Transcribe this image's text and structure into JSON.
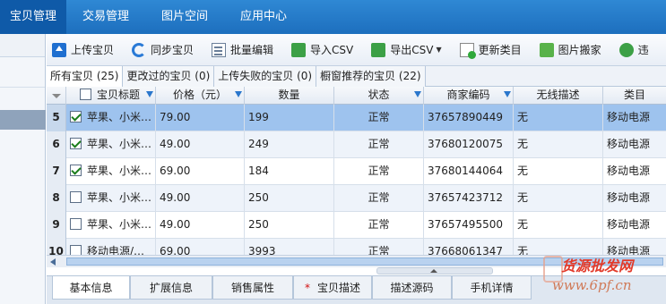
{
  "topnav": {
    "items": [
      {
        "label": "宝贝管理",
        "active": true
      },
      {
        "label": "交易管理"
      },
      {
        "label": "图片空间"
      },
      {
        "label": "应用中心"
      }
    ]
  },
  "toolbar": {
    "upload": "上传宝贝",
    "sync": "同步宝贝",
    "batch_edit": "批量编辑",
    "import_csv": "导入CSV",
    "export_csv": "导出CSV",
    "update_category": "更新类目",
    "image_move": "图片搬家",
    "check": "违"
  },
  "tabs": [
    {
      "label": "所有宝贝 (25)",
      "active": true
    },
    {
      "label": "更改过的宝贝 (0)"
    },
    {
      "label": "上传失败的宝贝 (0)"
    },
    {
      "label": "橱窗推荐的宝贝 (22)"
    }
  ],
  "columns": {
    "title": "宝贝标题",
    "price": "价格（元）",
    "qty": "数量",
    "status": "状态",
    "code": "商家编码",
    "wireless": "无线描述",
    "category": "类目"
  },
  "rows": [
    {
      "num": "5",
      "checked": true,
      "title": "苹果、小米…",
      "price": "79.00",
      "qty": "199",
      "status": "正常",
      "code": "37657890449",
      "wireless": "无",
      "category": "移动电源"
    },
    {
      "num": "6",
      "checked": true,
      "title": "苹果、小米…",
      "price": "49.00",
      "qty": "249",
      "status": "正常",
      "code": "37680120075",
      "wireless": "无",
      "category": "移动电源"
    },
    {
      "num": "7",
      "checked": true,
      "title": "苹果、小米…",
      "price": "69.00",
      "qty": "184",
      "status": "正常",
      "code": "37680144064",
      "wireless": "无",
      "category": "移动电源"
    },
    {
      "num": "8",
      "checked": false,
      "title": "苹果、小米…",
      "price": "49.00",
      "qty": "250",
      "status": "正常",
      "code": "37657423712",
      "wireless": "无",
      "category": "移动电源"
    },
    {
      "num": "9",
      "checked": false,
      "title": "苹果、小米…",
      "price": "49.00",
      "qty": "250",
      "status": "正常",
      "code": "37657495500",
      "wireless": "无",
      "category": "移动电源"
    },
    {
      "num": "10",
      "checked": false,
      "title": "移动电源/…",
      "price": "69.00",
      "qty": "3993",
      "status": "正常",
      "code": "37668061347",
      "wireless": "无",
      "category": "移动电源"
    }
  ],
  "bottom_tabs": [
    {
      "label": "基本信息",
      "active": true
    },
    {
      "label": "扩展信息"
    },
    {
      "label": "销售属性"
    },
    {
      "label": "宝贝描述",
      "required": "*"
    },
    {
      "label": "描述源码"
    },
    {
      "label": "手机详情"
    }
  ],
  "watermark": {
    "line1": "货源批发网",
    "line2": "www.6pf.cn"
  },
  "colors": {
    "nav": "#1d6fbe",
    "selected_row": "#9ec3ee",
    "filter": "#2a77cc"
  }
}
